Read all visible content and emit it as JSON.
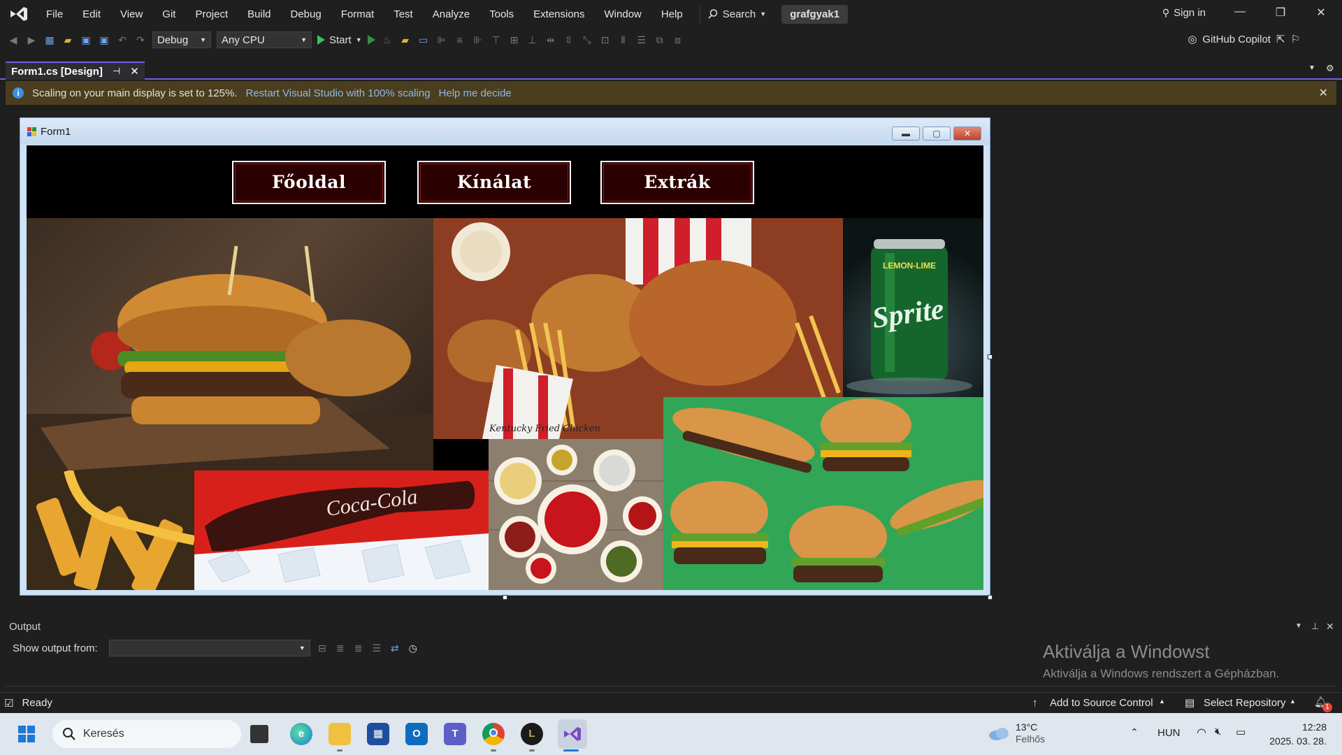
{
  "titlebar": {
    "menu": [
      "File",
      "Edit",
      "View",
      "Git",
      "Project",
      "Build",
      "Debug",
      "Format",
      "Test",
      "Analyze",
      "Tools",
      "Extensions",
      "Window",
      "Help"
    ],
    "search_label": "Search",
    "project_name": "grafgyak1",
    "signin_label": "Sign in"
  },
  "toolbar": {
    "config": "Debug",
    "platform": "Any CPU",
    "start_label": "Start",
    "copilot_label": "GitHub Copilot"
  },
  "doc_tab": {
    "title": "Form1.cs [Design]"
  },
  "infobar": {
    "message": "Scaling on your main display is set to 125%.",
    "link_restart": "Restart Visual Studio with 100% scaling",
    "link_help": "Help me decide"
  },
  "form": {
    "title": "Form1",
    "nav_buttons": [
      "Főoldal",
      "Kínálat",
      "Extrák"
    ],
    "tiles": {
      "sprite_label": "LEMON-LIME",
      "sprite_brand": "Sprite",
      "coke_brand": "Coca-Cola",
      "kfc_label": "Kentucky Fried Chicken"
    }
  },
  "output": {
    "title": "Output",
    "show_from_label": "Show output from:",
    "watermark_title": "Aktiválja a Windowst",
    "watermark_sub": "Aktiválja a Windows rendszert a Gépházban."
  },
  "statusbar": {
    "ready": "Ready",
    "source_control": "Add to Source Control",
    "select_repo": "Select Repository"
  },
  "taskbar": {
    "search_placeholder": "Keresés",
    "weather_temp": "13°C",
    "weather_desc": "Felhős",
    "lang": "HUN",
    "time": "12:28",
    "date": "2025. 03. 28.",
    "notif_count": "1"
  },
  "colors": {
    "accent": "#7160e8",
    "info_bar": "#4a3e1e",
    "nav_button_bg": "#2a0000",
    "form_border": "#cfe3f7"
  }
}
